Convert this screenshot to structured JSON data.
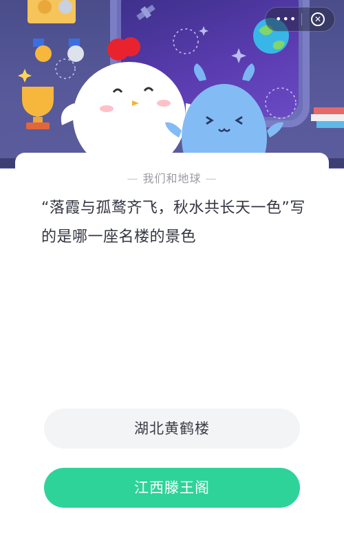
{
  "nav": {
    "more_glyph": "•••",
    "close_glyph": "✕"
  },
  "quiz": {
    "topic": "我们和地球",
    "question": "“落霞与孤鹜齐飞，秋水共长天一色”写的是哪一座名楼的景色",
    "options": [
      {
        "label": "湖北黄鹤楼"
      },
      {
        "label": "江西滕王阁"
      }
    ]
  },
  "colors": {
    "header_bg": "#4a4d8a",
    "accent_green": "#2ed39a",
    "option_bg": "#f3f4f6"
  }
}
